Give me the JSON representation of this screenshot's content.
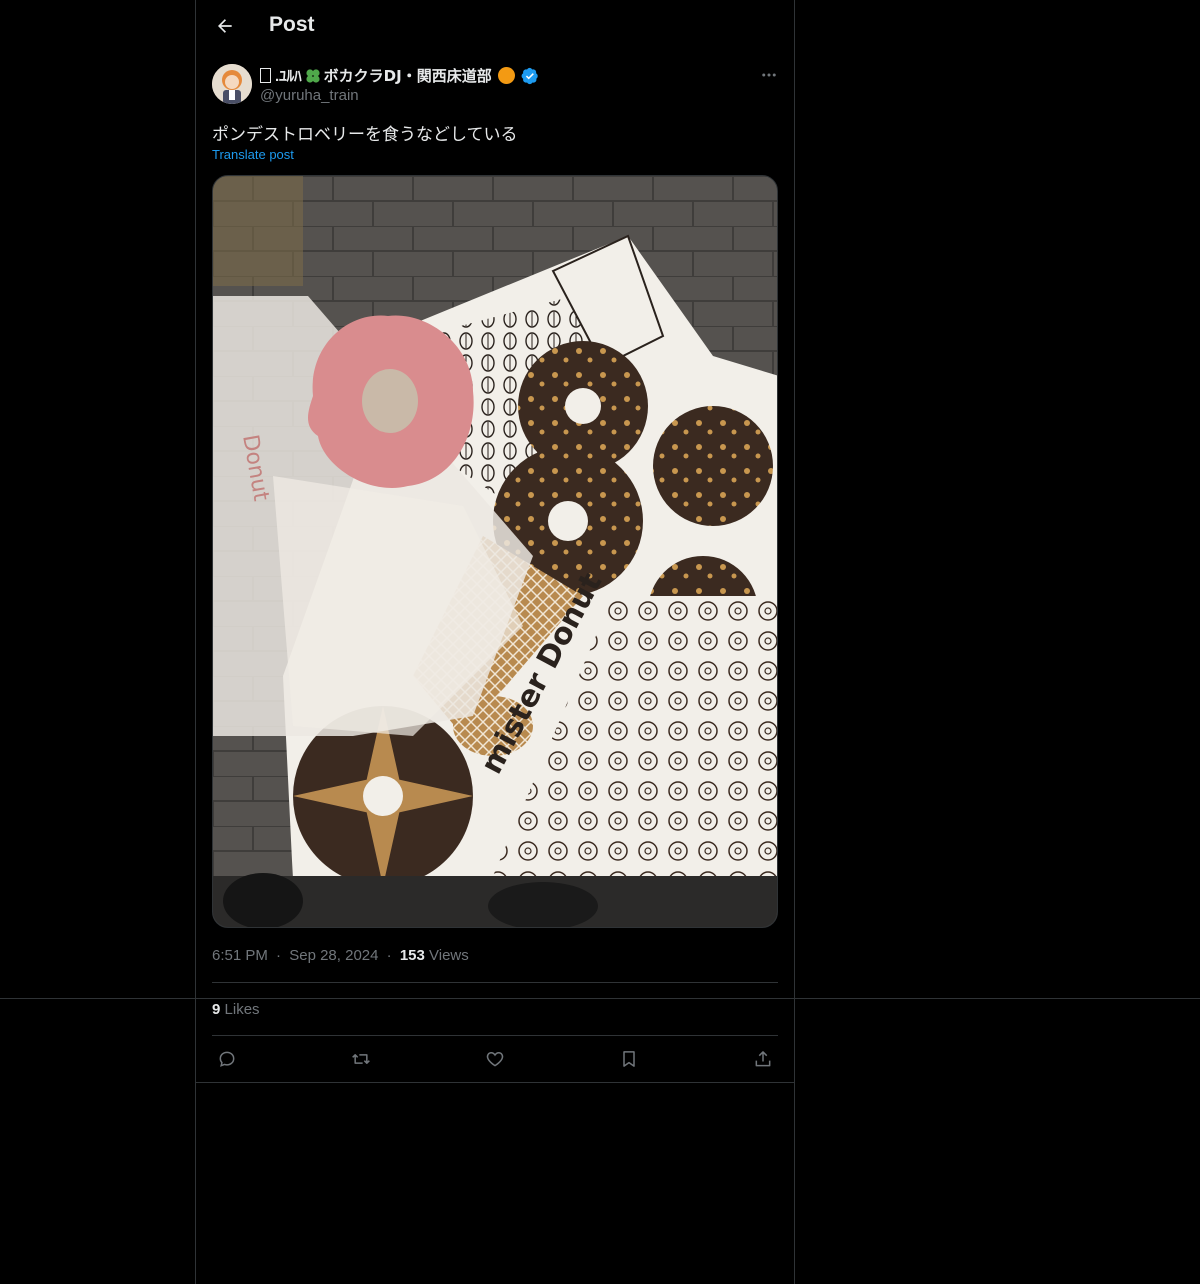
{
  "header": {
    "title": "Post"
  },
  "post": {
    "author": {
      "name_prefix": ".ﾕﾙﾊ",
      "name_main": "ボカクラDJ・関西床道部",
      "handle": "@yuruha_train",
      "verified": true
    },
    "text": "ポンデストロベリーを食うなどしている",
    "translate_label": "Translate post",
    "media_text": "mister Donut",
    "time": "6:51 PM",
    "date": "Sep 28, 2024",
    "dot": "·",
    "views_count": "153",
    "views_label": "Views",
    "likes_count": "9",
    "likes_label": "Likes"
  },
  "icons": {
    "back": "arrow-left-icon",
    "more": "more-horizontal-icon",
    "reply": "reply-icon",
    "repost": "repost-icon",
    "like": "heart-icon",
    "bookmark": "bookmark-icon",
    "share": "share-icon"
  },
  "colors": {
    "background": "#000000",
    "text": "#e7e9ea",
    "muted": "#71767b",
    "accent": "#1d9bf0",
    "border": "#2f3336"
  }
}
